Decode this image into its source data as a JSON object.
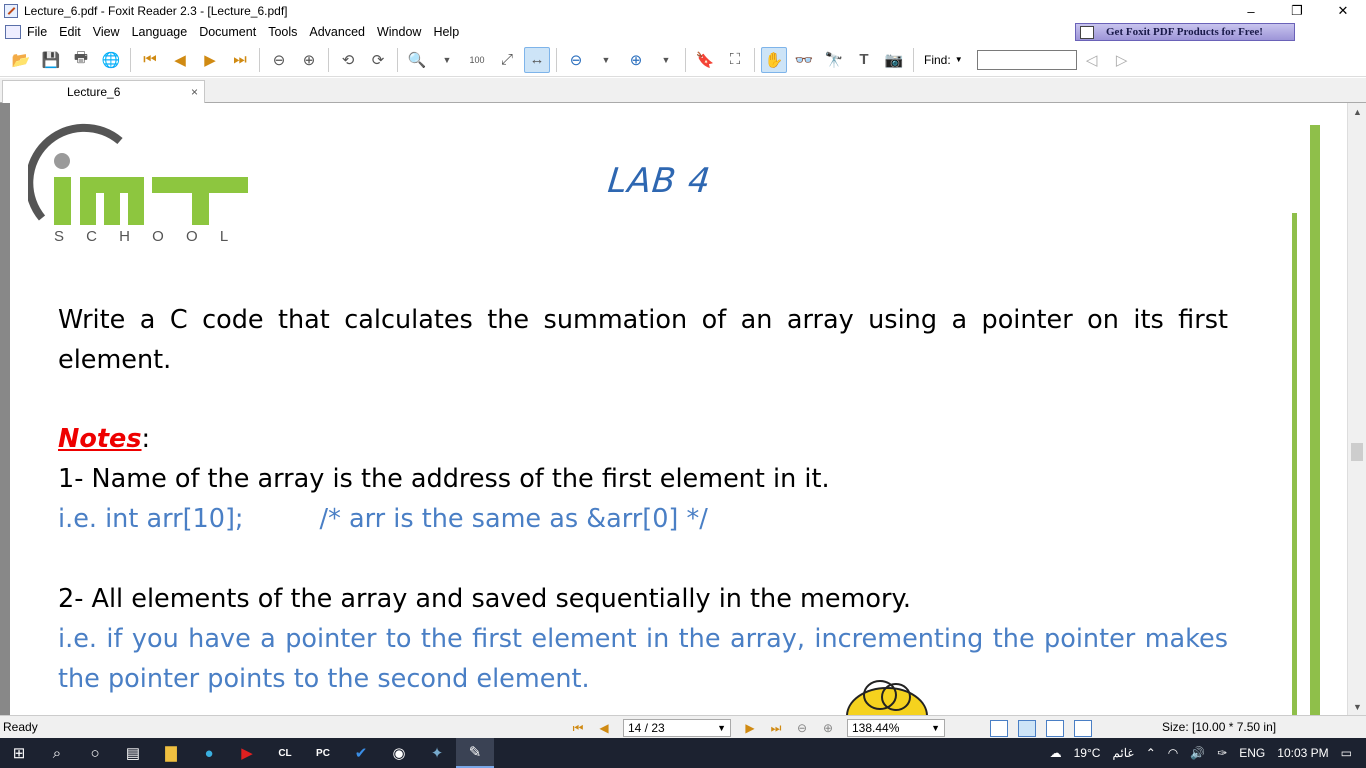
{
  "window": {
    "title": "Lecture_6.pdf - Foxit Reader 2.3 - [Lecture_6.pdf]",
    "controls": [
      "–",
      "❐",
      "✕"
    ]
  },
  "menu": [
    "File",
    "Edit",
    "View",
    "Language",
    "Document",
    "Tools",
    "Advanced",
    "Window",
    "Help"
  ],
  "promo": "Get Foxit PDF Products for Free!",
  "toolbar": {
    "find_label": "Find:",
    "find_value": ""
  },
  "tab": {
    "label": "Lecture_6",
    "close": "×"
  },
  "page": {
    "lab_title": "LAB 4",
    "logo_sub": "S C H O O L",
    "task": "Write a C code that calculates the summation of an array using a pointer on its first element.",
    "notes_label": "Notes",
    "notes_colon": ":",
    "note1": "1- Name of the array is the address of the first element in it.",
    "note1_example_code": "i.e. int arr[10];",
    "note1_example_comment": "/* arr is the same as &arr[0] */",
    "note2": "2- All elements of the array and saved sequentially in the memory.",
    "note2_example": "i.e. if you have a pointer to the first element in the array, incrementing the pointer makes the pointer points to the second element."
  },
  "statusbar": {
    "status": "Ready",
    "page_indicator": "14 / 23",
    "zoom": "138.44%",
    "size": "Size: [10.00 * 7.50 in]"
  },
  "taskbar": {
    "weather": "19°C",
    "weather_text": "غائم",
    "lang": "ENG",
    "time": "10:03 PM"
  }
}
